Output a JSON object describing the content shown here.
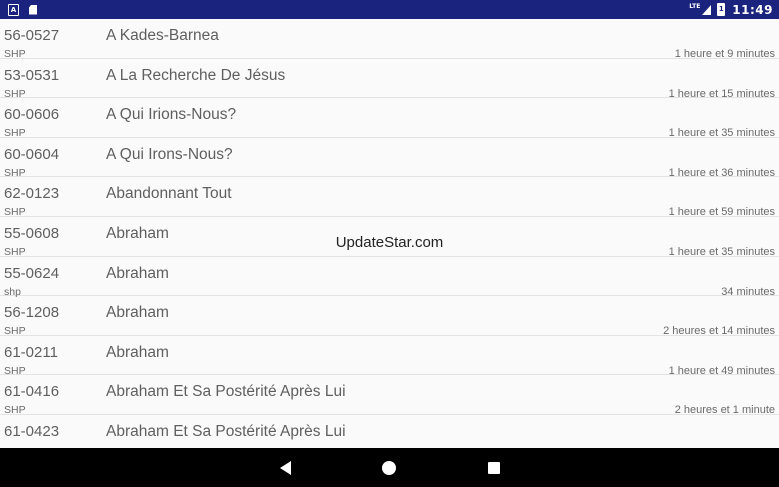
{
  "status_bar": {
    "left_icons": [
      "a-notification-icon",
      "sd-card-icon"
    ],
    "network": "LTE",
    "battery_label": "1",
    "time": "11:49"
  },
  "sermons": [
    {
      "code": "56-0527",
      "title": "A Kades-Barnea",
      "source": "SHP",
      "duration": "1 heure et 9 minutes"
    },
    {
      "code": "53-0531",
      "title": "A La Recherche De Jésus",
      "source": "SHP",
      "duration": "1 heure et 15 minutes"
    },
    {
      "code": "60-0606",
      "title": "A Qui Irions-Nous?",
      "source": "SHP",
      "duration": "1 heure et 35 minutes"
    },
    {
      "code": "60-0604",
      "title": "A Qui Irons-Nous?",
      "source": "SHP",
      "duration": "1 heure et 36 minutes"
    },
    {
      "code": "62-0123",
      "title": "Abandonnant Tout",
      "source": "SHP",
      "duration": "1 heure et 59 minutes"
    },
    {
      "code": "55-0608",
      "title": "Abraham",
      "source": "SHP",
      "duration": "1 heure et 35 minutes"
    },
    {
      "code": "55-0624",
      "title": "Abraham",
      "source": "shp",
      "duration": "34 minutes"
    },
    {
      "code": "56-1208",
      "title": "Abraham",
      "source": "SHP",
      "duration": "2 heures et 14 minutes"
    },
    {
      "code": "61-0211",
      "title": "Abraham",
      "source": "SHP",
      "duration": "1 heure et 49 minutes"
    },
    {
      "code": "61-0416",
      "title": "Abraham Et Sa Postérité Après Lui",
      "source": "SHP",
      "duration": "2 heures et 1 minute"
    },
    {
      "code": "61-0423",
      "title": "Abraham Et Sa Postérité Après Lui",
      "source": "",
      "duration": ""
    }
  ],
  "watermark": "UpdateStar.com",
  "nav": {
    "icons": [
      "back-icon",
      "home-icon",
      "recents-icon"
    ]
  },
  "colors": {
    "status_bar": "#1a237e",
    "nav_bar": "#000000",
    "background": "#fafafa",
    "text": "#5f5f5f",
    "divider": "#e3e3e3"
  }
}
